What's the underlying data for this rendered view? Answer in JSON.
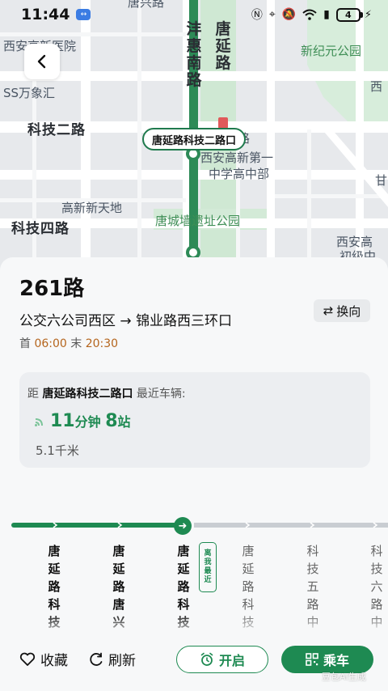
{
  "status_bar": {
    "time": "11:44",
    "battery": "4"
  },
  "map": {
    "labels": {
      "top_road": "唐兴路",
      "hospital": "西安高新医院",
      "xinjiyuan": "新纪元公园",
      "wanxiang": "SS万象汇",
      "keji2": "科技二路",
      "west_edge": "西",
      "school": "西安高新第一",
      "school2": "中学高中部",
      "xintiandi": "高新新天地",
      "keji4": "科技四路",
      "park": "唐城墙遗址公园",
      "east_edge": "甘",
      "xian_gao": "西安高",
      "junior": "初级中",
      "road_suffix": "路",
      "taohui": "沣惠南路",
      "tangyan": "唐延路"
    },
    "stop_callout": "唐延路科技二路口"
  },
  "route": {
    "name": "261路",
    "from": "公交六公司西区",
    "arrow": "→",
    "to": "锦业路西三环口",
    "swap_label": "换向",
    "first_label": "首",
    "first_time": "06:00",
    "last_label": "末",
    "last_time": "20:30"
  },
  "arrival": {
    "prefix": "距",
    "stop": "唐延路科技二路口",
    "suffix": "最近车辆:",
    "minutes": "11",
    "minutes_unit": "分钟",
    "stops": "8",
    "stops_unit": "站",
    "distance": "5.1千米"
  },
  "stops": [
    {
      "chars": "唐延路科技"
    },
    {
      "chars": "唐延路唐兴"
    },
    {
      "chars": "唐延路科技"
    },
    {
      "chars": "唐延路科技"
    },
    {
      "chars": "科技五路中"
    },
    {
      "chars": "科技六路中"
    }
  ],
  "near_badge": "离我最近",
  "actions": {
    "favorite": "收藏",
    "refresh": "刷新",
    "remind": "开启",
    "board": "乘车"
  },
  "watermark": "豆包AI生成",
  "colors": {
    "brand_green": "#1e8a52",
    "time_orange": "#b5651d",
    "route_line": "#2d8a57"
  }
}
